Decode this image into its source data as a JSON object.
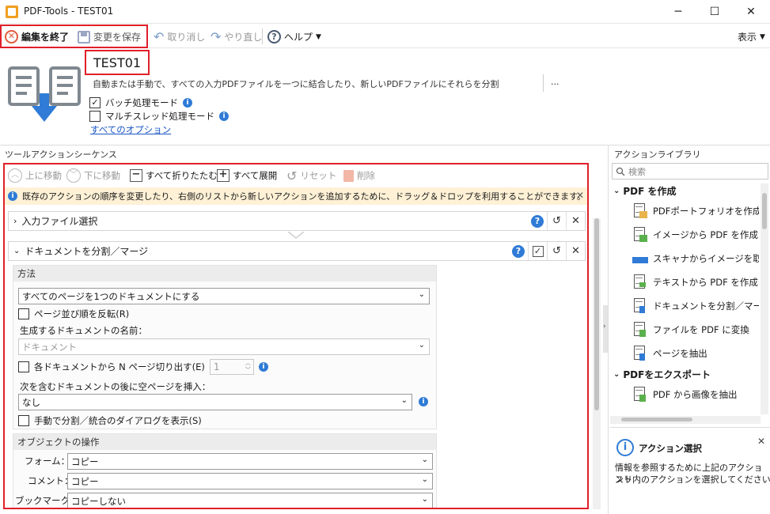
{
  "window": {
    "title": "PDF-Tools - TEST01",
    "minimize": "─",
    "maximize": "☐",
    "close": "✕"
  },
  "toolbar": {
    "exit_edit": "編集を終了",
    "save_changes": "変更を保存",
    "undo": "取り消し",
    "redo": "やり直し",
    "help": "ヘルプ",
    "view": "表示"
  },
  "header": {
    "title": "TEST01",
    "description": "自動または手動で、すべての入力PDFファイルを一つに結合したり、新しいPDFファイルにそれらを分割",
    "more": "...",
    "batch_mode": "バッチ処理モード",
    "batch_checked": true,
    "multithread_mode": "マルチスレッド処理モード",
    "multithread_checked": false,
    "all_options": "すべてのオプション"
  },
  "sequence": {
    "label": "ツールアクションシーケンス",
    "toolbar": {
      "move_up": "上に移動",
      "move_down": "下に移動",
      "collapse_all": "すべて折りたたむ",
      "expand_all": "すべて展開",
      "reset": "リセット",
      "delete": "削除"
    },
    "info": "既存のアクションの順序を変更したり、右側のリストから新しいアクションを追加するために、ドラッグ＆ドロップを利用することができます。",
    "panels": [
      {
        "title": "入力ファイル選択",
        "expanded": false
      },
      {
        "title": "ドキュメントを分割／マージ",
        "expanded": true
      }
    ],
    "method": {
      "group_title": "方法",
      "mode_value": "すべてのページを1つのドキュメントにする",
      "reverse_pages": "ページ並び順を反転(R)",
      "doc_name_label": "生成するドキュメントの名前：",
      "doc_name_value": "ドキュメント",
      "extract_n": "各ドキュメントから N ページ切り出す(E)",
      "extract_n_value": "1",
      "insert_blank_label": "次を含むドキュメントの後に空ページを挿入：",
      "insert_blank_value": "なし",
      "show_dialog": "手動で分割／統合のダイアログを表示(S)"
    },
    "objects": {
      "group_title": "オブジェクトの操作",
      "form_label": "フォーム：",
      "form_value": "コピー",
      "comment_label": "コメント：",
      "comment_value": "コピー",
      "bookmark_label": "ブックマーク：",
      "bookmark_value": "コピーしない"
    }
  },
  "library": {
    "label": "アクションライブラリ",
    "search_placeholder": "検索",
    "categories": [
      {
        "name": "PDF を作成",
        "items": [
          "PDFポートフォリオを作成",
          "イメージから PDF を作成",
          "スキャナからイメージを取得",
          "テキストから PDF を作成",
          "ドキュメントを分割／マージ",
          "ファイルを PDF に変換",
          "ページを抽出"
        ]
      },
      {
        "name": "PDFをエクスポート",
        "items": [
          "PDF から画像を抽出"
        ]
      }
    ],
    "info_title": "アクション選択",
    "info_text_1": "情報を参照するために上記のアクションリ",
    "info_text_2": "スト内のアクションを選択してください"
  },
  "colors": {
    "accent_red": "#e0202a",
    "info_blue": "#2f7bd6",
    "banner": "#fff1d6"
  }
}
